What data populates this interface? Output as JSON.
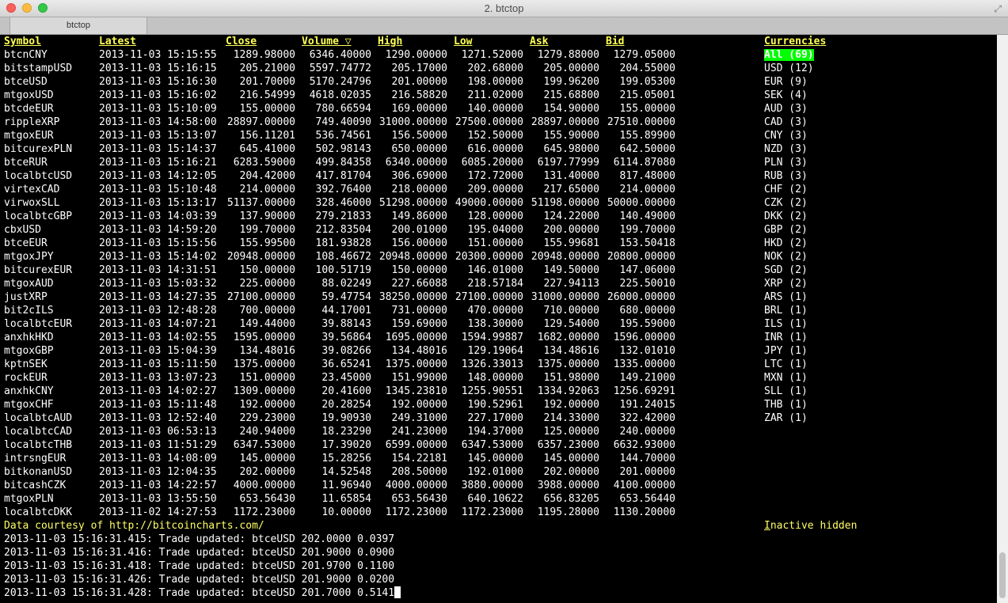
{
  "window": {
    "title": "2. btctop",
    "tab_label": "btctop"
  },
  "columns": [
    "Symbol",
    "Latest",
    "Close",
    "Volume ▽",
    "High",
    "Low",
    "Ask",
    "Bid"
  ],
  "currencies_header": "Currencies",
  "rows": [
    [
      "btcnCNY",
      "2013-11-03 15:15:55",
      "1289.98000",
      "6346.40000",
      "1290.00000",
      "1271.52000",
      "1279.88000",
      "1279.05000"
    ],
    [
      "bitstampUSD",
      "2013-11-03 15:16:15",
      "205.21000",
      "5597.74772",
      "205.17000",
      "202.68000",
      "205.00000",
      "204.55000"
    ],
    [
      "btceUSD",
      "2013-11-03 15:16:30",
      "201.70000",
      "5170.24796",
      "201.00000",
      "198.00000",
      "199.96200",
      "199.05300"
    ],
    [
      "mtgoxUSD",
      "2013-11-03 15:16:02",
      "216.54999",
      "4618.02035",
      "216.58820",
      "211.02000",
      "215.68800",
      "215.05001"
    ],
    [
      "btcdeEUR",
      "2013-11-03 15:10:09",
      "155.00000",
      "780.66594",
      "169.00000",
      "140.00000",
      "154.90000",
      "155.00000"
    ],
    [
      "rippleXRP",
      "2013-11-03 14:58:00",
      "28897.00000",
      "749.40090",
      "31000.00000",
      "27500.00000",
      "28897.00000",
      "27510.00000"
    ],
    [
      "mtgoxEUR",
      "2013-11-03 15:13:07",
      "156.11201",
      "536.74561",
      "156.50000",
      "152.50000",
      "155.90000",
      "155.89900"
    ],
    [
      "bitcurexPLN",
      "2013-11-03 15:14:37",
      "645.41000",
      "502.98143",
      "650.00000",
      "616.00000",
      "645.98000",
      "642.50000"
    ],
    [
      "btceRUR",
      "2013-11-03 15:16:21",
      "6283.59000",
      "499.84358",
      "6340.00000",
      "6085.20000",
      "6197.77999",
      "6114.87080"
    ],
    [
      "localbtcUSD",
      "2013-11-03 14:12:05",
      "204.42000",
      "417.81704",
      "306.69000",
      "172.72000",
      "131.40000",
      "817.48000"
    ],
    [
      "virtexCAD",
      "2013-11-03 15:10:48",
      "214.00000",
      "392.76400",
      "218.00000",
      "209.00000",
      "217.65000",
      "214.00000"
    ],
    [
      "virwoxSLL",
      "2013-11-03 15:13:17",
      "51137.00000",
      "328.46000",
      "51298.00000",
      "49000.00000",
      "51198.00000",
      "50000.00000"
    ],
    [
      "localbtcGBP",
      "2013-11-03 14:03:39",
      "137.90000",
      "279.21833",
      "149.86000",
      "128.00000",
      "124.22000",
      "140.49000"
    ],
    [
      "cbxUSD",
      "2013-11-03 14:59:20",
      "199.70000",
      "212.83504",
      "200.01000",
      "195.04000",
      "200.00000",
      "199.70000"
    ],
    [
      "btceEUR",
      "2013-11-03 15:15:56",
      "155.99500",
      "181.93828",
      "156.00000",
      "151.00000",
      "155.99681",
      "153.50418"
    ],
    [
      "mtgoxJPY",
      "2013-11-03 15:14:02",
      "20948.00000",
      "108.46672",
      "20948.00000",
      "20300.00000",
      "20948.00000",
      "20800.00000"
    ],
    [
      "bitcurexEUR",
      "2013-11-03 14:31:51",
      "150.00000",
      "100.51719",
      "150.00000",
      "146.01000",
      "149.50000",
      "147.06000"
    ],
    [
      "mtgoxAUD",
      "2013-11-03 15:03:32",
      "225.00000",
      "88.02249",
      "227.66088",
      "218.57184",
      "227.94113",
      "225.50010"
    ],
    [
      "justXRP",
      "2013-11-03 14:27:35",
      "27100.00000",
      "59.47754",
      "38250.00000",
      "27100.00000",
      "31000.00000",
      "26000.00000"
    ],
    [
      "bit2cILS",
      "2013-11-03 12:48:28",
      "700.00000",
      "44.17001",
      "731.00000",
      "470.00000",
      "710.00000",
      "680.00000"
    ],
    [
      "localbtcEUR",
      "2013-11-03 14:07:21",
      "149.44000",
      "39.88143",
      "159.69000",
      "138.30000",
      "129.54000",
      "195.59000"
    ],
    [
      "anxhkHKD",
      "2013-11-03 14:02:55",
      "1595.00000",
      "39.56864",
      "1695.00000",
      "1594.99887",
      "1682.00000",
      "1596.00000"
    ],
    [
      "mtgoxGBP",
      "2013-11-03 15:04:39",
      "134.48016",
      "39.08266",
      "134.48016",
      "129.19064",
      "134.48616",
      "132.01010"
    ],
    [
      "kptnSEK",
      "2013-11-03 15:11:50",
      "1375.00000",
      "36.65241",
      "1375.00000",
      "1326.33013",
      "1375.00000",
      "1335.00000"
    ],
    [
      "rockEUR",
      "2013-11-03 13:07:23",
      "151.00000",
      "23.45000",
      "151.99000",
      "148.00000",
      "151.98000",
      "149.21000"
    ],
    [
      "anxhkCNY",
      "2013-11-03 14:02:27",
      "1309.00000",
      "20.41600",
      "1345.23810",
      "1255.90551",
      "1334.92063",
      "1256.69291"
    ],
    [
      "mtgoxCHF",
      "2013-11-03 15:11:48",
      "192.00000",
      "20.28254",
      "192.00000",
      "190.52961",
      "192.00000",
      "191.24015"
    ],
    [
      "localbtcAUD",
      "2013-11-03 12:52:40",
      "229.23000",
      "19.90930",
      "249.31000",
      "227.17000",
      "214.33000",
      "322.42000"
    ],
    [
      "localbtcCAD",
      "2013-11-03 06:53:13",
      "240.94000",
      "18.23290",
      "241.23000",
      "194.37000",
      "125.00000",
      "240.00000"
    ],
    [
      "localbtcTHB",
      "2013-11-03 11:51:29",
      "6347.53000",
      "17.39020",
      "6599.00000",
      "6347.53000",
      "6357.23000",
      "6632.93000"
    ],
    [
      "intrsngEUR",
      "2013-11-03 14:08:09",
      "145.00000",
      "15.28256",
      "154.22181",
      "145.00000",
      "145.00000",
      "144.70000"
    ],
    [
      "bitkonanUSD",
      "2013-11-03 12:04:35",
      "202.00000",
      "14.52548",
      "208.50000",
      "192.01000",
      "202.00000",
      "201.00000"
    ],
    [
      "bitcashCZK",
      "2013-11-03 14:22:57",
      "4000.00000",
      "11.96940",
      "4000.00000",
      "3880.00000",
      "3988.00000",
      "4100.00000"
    ],
    [
      "mtgoxPLN",
      "2013-11-03 13:55:50",
      "653.56430",
      "11.65854",
      "653.56430",
      "640.10622",
      "656.83205",
      "653.56440"
    ],
    [
      "localbtcDKK",
      "2013-11-02 14:27:53",
      "1172.23000",
      "10.00000",
      "1172.23000",
      "1172.23000",
      "1195.28000",
      "1130.20000"
    ]
  ],
  "currencies": [
    "All (69)",
    "USD (12)",
    "EUR (9)",
    "SEK (4)",
    "AUD (3)",
    "CAD (3)",
    "CNY (3)",
    "NZD (3)",
    "PLN (3)",
    "RUB (3)",
    "CHF (2)",
    "CZK (2)",
    "DKK (2)",
    "GBP (2)",
    "HKD (2)",
    "NOK (2)",
    "SGD (2)",
    "XRP (2)",
    "ARS (1)",
    "BRL (1)",
    "ILS (1)",
    "INR (1)",
    "JPY (1)",
    "LTC (1)",
    "MXN (1)",
    "SLL (1)",
    "THB (1)",
    "ZAR (1)"
  ],
  "courtesy": "Data courtesy of http://bitcoincharts.com/",
  "inactive_label": "Inactive hidden",
  "log": [
    "2013-11-03 15:16:31.415: Trade updated: btceUSD 202.0000 0.0397",
    "2013-11-03 15:16:31.416: Trade updated: btceUSD 201.9000 0.0900",
    "2013-11-03 15:16:31.418: Trade updated: btceUSD 201.9700 0.1100",
    "2013-11-03 15:16:31.426: Trade updated: btceUSD 201.9000 0.0200",
    "2013-11-03 15:16:31.428: Trade updated: btceUSD 201.7000 0.5141"
  ]
}
